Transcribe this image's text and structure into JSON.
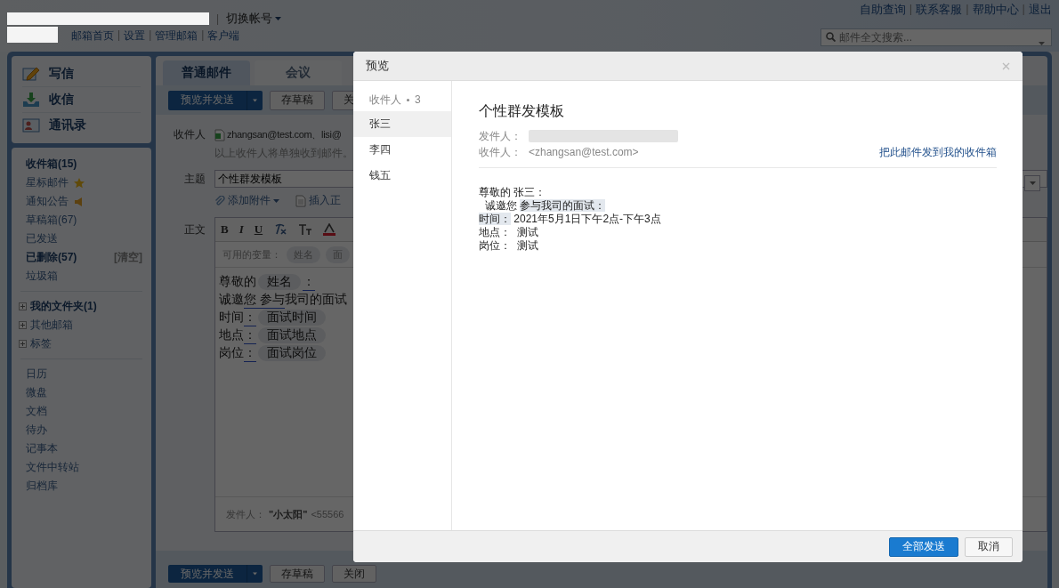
{
  "header": {
    "account_separator": "|",
    "switch_account": "切换帐号",
    "nav_links": [
      {
        "text": "邮箱首页",
        "kind": "link"
      },
      {
        "text": "|",
        "kind": "separator"
      },
      {
        "text": "设置",
        "kind": "link"
      },
      {
        "text": "|",
        "kind": "separator"
      },
      {
        "text": "管理邮箱",
        "kind": "link"
      },
      {
        "text": "|",
        "kind": "separator"
      },
      {
        "text": "客户端",
        "kind": "link"
      }
    ],
    "top_links": [
      {
        "text": "自助查询",
        "kind": "link"
      },
      {
        "text": "|",
        "kind": "separator"
      },
      {
        "text": "联系客服",
        "kind": "link"
      },
      {
        "text": "|",
        "kind": "separator"
      },
      {
        "text": "帮助中心",
        "kind": "link"
      },
      {
        "text": "|",
        "kind": "separator"
      },
      {
        "text": "退出",
        "kind": "link"
      }
    ],
    "search": {
      "placeholder": "邮件全文搜索..."
    }
  },
  "sidebar": {
    "actions": [
      {
        "label": "写信",
        "kind": "compose"
      },
      {
        "label": "收信",
        "kind": "receive"
      },
      {
        "label": "通讯录",
        "kind": "contacts"
      }
    ],
    "folders": [
      {
        "label": "收件箱(15)",
        "has_unread": true
      },
      {
        "label": "星标邮件",
        "has_unread": false,
        "kind": "star"
      },
      {
        "label": "通知公告",
        "has_unread": false,
        "kind": "speaker"
      },
      {
        "label": "草稿箱(67)",
        "has_unread": false
      },
      {
        "label": "已发送",
        "has_unread": false
      },
      {
        "label": "已删除(57)",
        "has_unread": true,
        "action": "[清空]"
      },
      {
        "label": "垃圾箱",
        "has_unread": false
      }
    ],
    "groups": [
      {
        "label": "我的文件夹(1)",
        "has_unread": true,
        "expanded": false
      },
      {
        "label": "其他邮箱",
        "has_unread": false,
        "expanded": false
      },
      {
        "label": "标签",
        "has_unread": false,
        "expanded": false
      }
    ],
    "tools": [
      "日历",
      "微盘",
      "文档",
      "待办",
      "记事本",
      "文件中转站",
      "归档库"
    ]
  },
  "compose": {
    "tabs": [
      {
        "label": "普通邮件",
        "selected": true
      },
      {
        "label": "会议",
        "selected": false
      }
    ],
    "toolbar": [
      "预览并发送",
      "存草稿",
      "关"
    ],
    "recipients_label": "收件人",
    "recipients": "zhangsan@test.com、lisi@",
    "recipients_hint": "以上收件人将单独收到邮件。",
    "subject_label": "主题",
    "subject": "个性群发模板",
    "attach": "添加附件",
    "insert": "插入正",
    "body_label": "正文",
    "format_buttons": [
      "B",
      "I",
      "U"
    ],
    "variables_label": "可用的变量：",
    "variables": [
      "姓名",
      "面"
    ],
    "lines": [
      [
        {
          "text": "尊敬的",
          "kind": "text"
        },
        {
          "text": "姓名",
          "kind": "chip"
        },
        {
          "text": "：",
          "kind": "underlined"
        }
      ],
      [
        {
          "text": "诚邀",
          "kind": "text"
        },
        {
          "text": "您 参与",
          "kind": "underlined"
        },
        {
          "text": "我司的面试",
          "kind": "text"
        }
      ],
      [
        {
          "text": "时间",
          "kind": "text"
        },
        {
          "text": "：",
          "kind": "underlined"
        },
        {
          "text": "面试时间",
          "kind": "chip"
        }
      ],
      [
        {
          "text": "地点",
          "kind": "text"
        },
        {
          "text": "：",
          "kind": "underlined"
        },
        {
          "text": "面试地点",
          "kind": "chip"
        }
      ],
      [
        {
          "text": "岗位",
          "kind": "text"
        },
        {
          "text": "：",
          "kind": "underlined"
        },
        {
          "text": "面试岗位",
          "kind": "chip"
        }
      ]
    ],
    "sender_label": "发件人：",
    "sender_name": "\"小太阳\"",
    "sender_address": "<55566",
    "bottom_toolbar": [
      "预览并发送",
      "存草稿",
      "关闭"
    ]
  },
  "preview": {
    "title": "预览",
    "recipients_label": "收件人",
    "recipients_count": "3",
    "recipients": [
      {
        "name": "张三",
        "selected": true
      },
      {
        "name": "李四",
        "selected": false
      },
      {
        "name": "钱五",
        "selected": false
      }
    ],
    "subject": "个性群发模板",
    "from_label": "发件人：",
    "to_label": "收件人：",
    "to_value": "<zhangsan@test.com>",
    "forward_link": "把此邮件发到我的收件箱",
    "body": [
      [
        {
          "text": "尊敬的 张三：",
          "highlight": false
        }
      ],
      [
        {
          "text": "  诚邀您 ",
          "highlight": false
        },
        {
          "text": "参与我司的面试：",
          "highlight": true
        }
      ],
      [
        {
          "text": "时间：",
          "highlight": true
        },
        {
          "text": " 2021年5月1日下午2点-下午3点",
          "highlight": false
        }
      ],
      [
        {
          "text": "地点：  测试",
          "highlight": false
        }
      ],
      [
        {
          "text": "岗位：  测试",
          "highlight": false
        }
      ]
    ],
    "buttons": [
      {
        "label": "全部发送",
        "kind": "primary"
      },
      {
        "label": "取消",
        "kind": "secondary"
      }
    ]
  }
}
